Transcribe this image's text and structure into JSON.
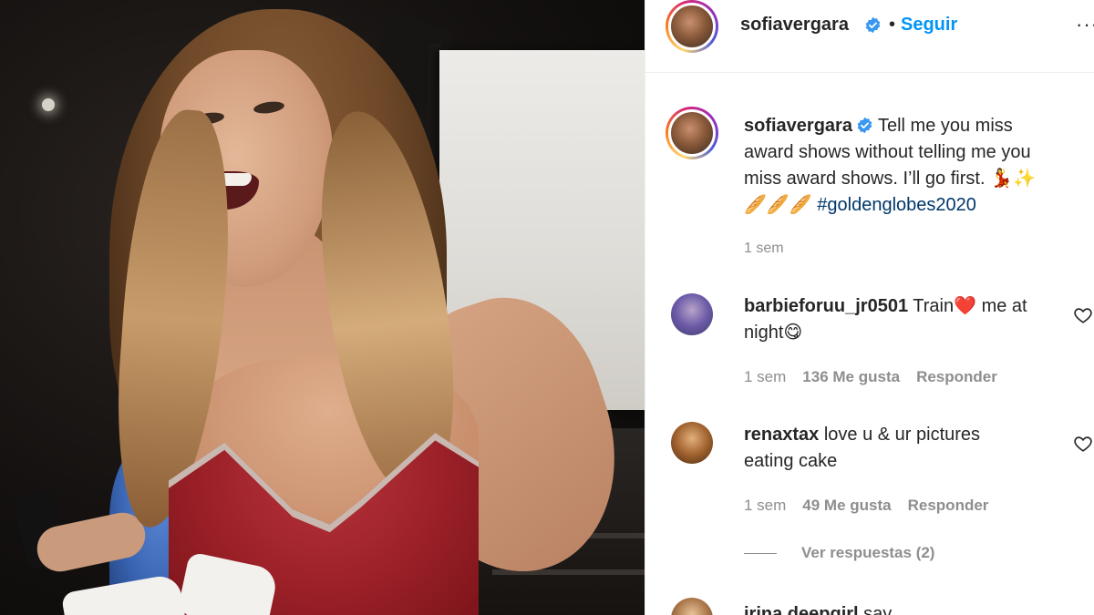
{
  "post": {
    "username": "sofiavergara",
    "separator": "•",
    "follow_label": "Seguir",
    "more_icon": "···"
  },
  "caption": {
    "username": "sofiavergara",
    "line1": "Tell me you miss",
    "line2": "award shows without telling me you",
    "line3": "miss award shows. I’ll go first. 💃✨",
    "line4_emoji": "🥖🥖🥖",
    "hashtag": "#goldenglobes2020",
    "time": "1 sem"
  },
  "comments": [
    {
      "username": "barbieforuu_jr0501",
      "text_a": "Train",
      "heart_emoji": "❤️",
      "text_b": "me at",
      "line2": "night😋",
      "time": "1 sem",
      "likes": "136 Me gusta",
      "reply_label": "Responder"
    },
    {
      "username": "renaxtax",
      "line1": "love u & ur pictures",
      "line2": "eating cake",
      "time": "1 sem",
      "likes": "49 Me gusta",
      "reply_label": "Responder",
      "view_replies": "Ver respuestas (2)"
    },
    {
      "username": "irina.deepgirl",
      "text": "say"
    }
  ],
  "colors": {
    "follow_blue": "#0095f6",
    "hashtag_blue": "#00376b",
    "muted_gray": "#8e8e8e",
    "verified_blue": "#3897f0"
  },
  "icons": [
    "verified-badge-icon",
    "more-options-icon",
    "heart-outline-icon"
  ]
}
